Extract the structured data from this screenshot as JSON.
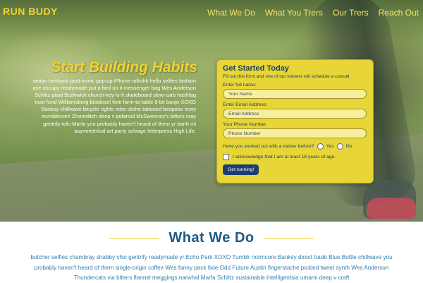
{
  "brand": "RUN BUDY",
  "nav": [
    "What We Do",
    "What You Trers",
    "Our Trers",
    "Reach Out"
  ],
  "hero": {
    "title": "Start Building Habits",
    "copy": "seitan heirloom post-ironic pop-up iPhone mlkshk hella selfies fashion axe occupy readymade put a bird on it messenger bag Wes Anderson Schlitz plaid Bushwick church-key lo-fi skateboard slow-carb hashtag trust fund Williamsburg biodiesel fixie farm-to-table 8-bit banjo XOXO Banksy chillwave bicycle rights retro cliche tattooed bespoke irony mumblecore Shoreditch deep v polaroid McSweeney's bitters cray gentrify tofu Marfa you probably haven't heard of them yr banh mi asymmetrical art party selvage letterpress High Life."
  },
  "form": {
    "title": "Get Started Today",
    "subtitle": "Fill out this form and one of our trainers will schedule a consult",
    "name_label": "Enter full name:",
    "name_placeholder": "Your Name",
    "email_label": "Enter Email Address:",
    "email_placeholder": "Email Address",
    "phone_label": "Your Phone Number",
    "phone_placeholder": "Phone Number",
    "question": "Have you worked out with a trainer before?",
    "yes": "Yes",
    "no": "No",
    "age_check": "I acknowledge that I am at least 18 years of age.",
    "submit": "Get running!"
  },
  "what_we_do": {
    "title": "What We Do",
    "copy": "butcher selfies chambray shabby chic gentrify readymade yr Echo Park XOXO Tumblr normcore Banksy direct trade Blue Bottle chillwave you probably haven't heard of them single-origin coffee Wes fanny pack fixie Odd Future Austin fingerstache pickled tweet synth Wes Anderson Thundercats via bitters flannel meggings narwhal Marfa Schlitz sustainable Intelligentsia umami deep v craft"
  }
}
